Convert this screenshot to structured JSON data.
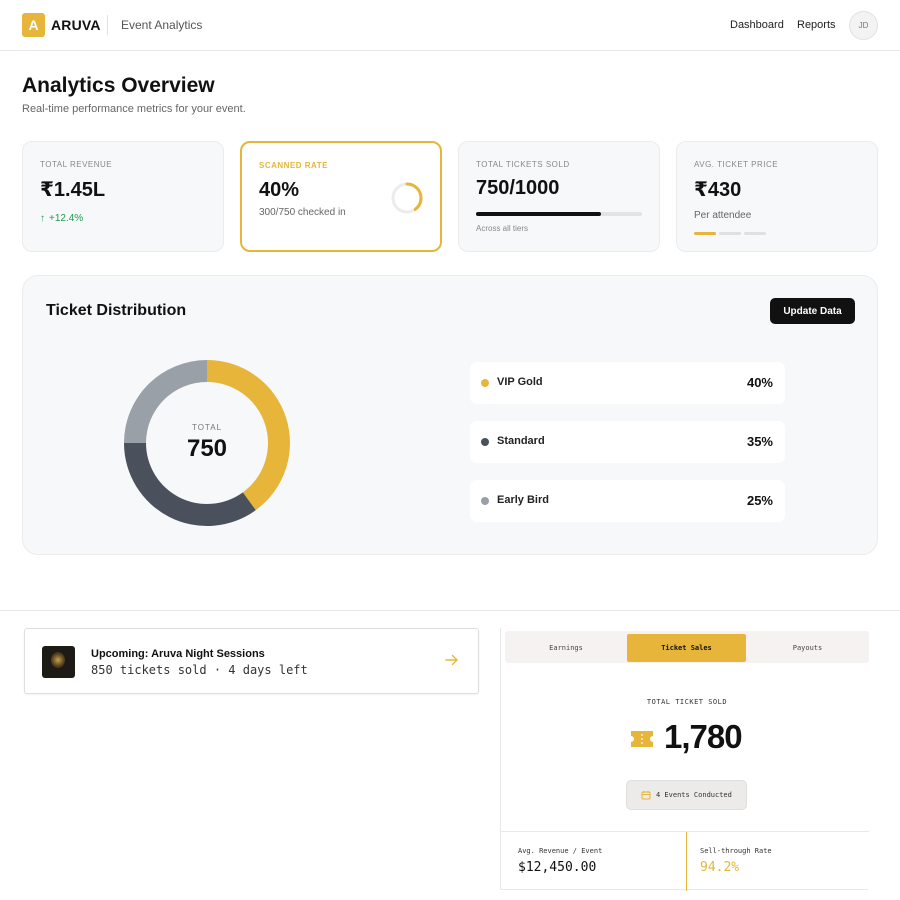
{
  "header": {
    "logo_letter": "A",
    "brand": "ARUVA",
    "app_name": "Event Analytics",
    "nav": {
      "dashboard": "Dashboard",
      "reports": "Reports"
    },
    "avatar_initials": "JD"
  },
  "page": {
    "title": "Analytics Overview",
    "subtitle": "Real-time performance metrics for your event."
  },
  "stats": {
    "revenue": {
      "label": "Total Revenue",
      "value": "₹1.45L",
      "trend": "+12.4%",
      "trend_icon": "arrow-up-icon"
    },
    "scanned": {
      "label": "Scanned Rate",
      "value": "40%",
      "sub": "300/750 checked in",
      "rate": 0.4
    },
    "tickets": {
      "label": "Total Tickets Sold",
      "value": "750/1000",
      "progress": 0.75,
      "foot": "Across all tiers"
    },
    "price": {
      "label": "Avg. Ticket Price",
      "value": "₹430",
      "sub": "Per attendee",
      "active_segment": 1,
      "segments": 3
    }
  },
  "distribution": {
    "title": "Ticket Distribution",
    "update_label": "Update Data",
    "center_label": "TOTAL",
    "center_value": "750",
    "tiers": [
      {
        "name": "VIP Gold",
        "pct_label": "40%",
        "share": 40,
        "color": "#e6b53a"
      },
      {
        "name": "Standard",
        "pct_label": "35%",
        "share": 35,
        "color": "#4a515c"
      },
      {
        "name": "Early Bird",
        "pct_label": "25%",
        "share": 25,
        "color": "#9aa0a8"
      }
    ]
  },
  "upcoming": {
    "title": "Upcoming: Aruva Night Sessions",
    "sub": "850 tickets sold · 4 days left",
    "arrow_icon": "arrow-right-icon"
  },
  "sales": {
    "tabs": [
      "Earnings",
      "Ticket Sales",
      "Payouts"
    ],
    "active_tab": "Ticket Sales",
    "total_label": "TOTAL TICKET SOLD",
    "total_value": "1,780",
    "events_badge": "4 Events Conducted",
    "metrics": [
      {
        "label": "Avg. Revenue / Event",
        "value": "$12,450.00"
      },
      {
        "label": "Sell-through Rate",
        "value": "94.2%"
      }
    ]
  },
  "colors": {
    "accent": "#e6b53a",
    "dark": "#111111",
    "positive": "#1f9d4c"
  }
}
